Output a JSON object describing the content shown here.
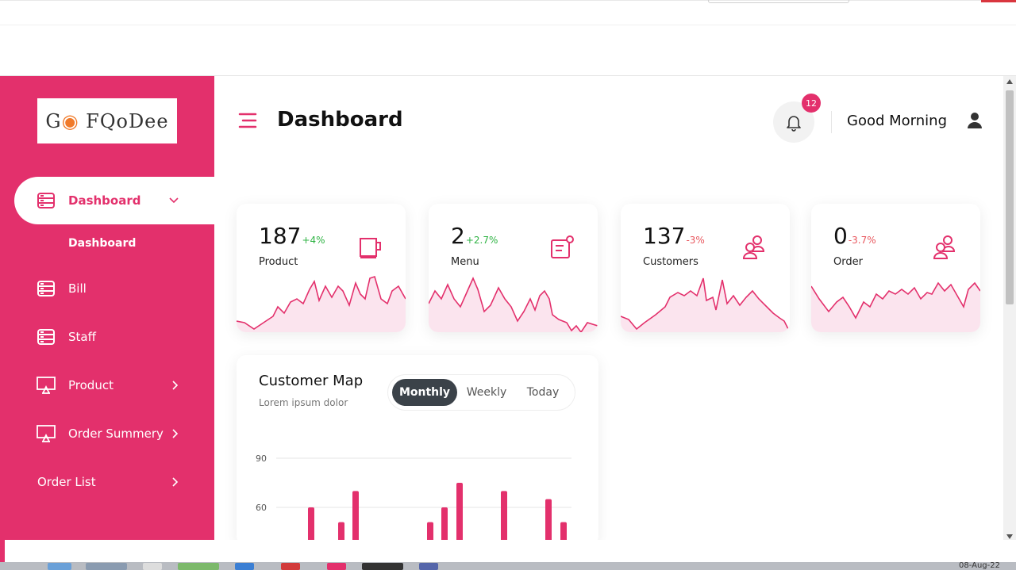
{
  "brand": {
    "logo_text": "GO FOoDee",
    "accent": "#e3306c",
    "dark": "#3b4249"
  },
  "sidebar": {
    "items": [
      {
        "label": "Dashboard",
        "icon": "list-icon",
        "active": true,
        "expanded": true
      },
      {
        "label": "Bill",
        "icon": "list-icon"
      },
      {
        "label": "Staff",
        "icon": "list-icon"
      },
      {
        "label": "Product",
        "icon": "monitor-icon"
      },
      {
        "label": "Order Summery",
        "icon": "monitor-icon"
      },
      {
        "label": "Order List"
      }
    ],
    "sub_items": [
      "Dashboard"
    ]
  },
  "header": {
    "title": "Dashboard",
    "notifications": "12",
    "greeting": "Good Morning"
  },
  "stats": [
    {
      "value": "187",
      "delta": "+4%",
      "label": "Product",
      "icon": "cup-icon",
      "trend": "up"
    },
    {
      "value": "2",
      "delta": "+2.7%",
      "label": "Menu",
      "icon": "menu-card-icon",
      "trend": "up"
    },
    {
      "value": "137",
      "delta": "-3%",
      "label": "Customers",
      "icon": "users-icon",
      "trend": "down"
    },
    {
      "value": "0",
      "delta": "-3.7%",
      "label": "Order",
      "icon": "users-icon",
      "trend": "down"
    }
  ],
  "customer_map": {
    "title": "Customer Map",
    "subtitle": "Lorem ipsum dolor",
    "tabs": [
      "Monthly",
      "Weekly",
      "Today"
    ],
    "active_tab": "Monthly"
  },
  "chart_data": {
    "type": "bar",
    "title": "Customer Map",
    "ytick_labels": [
      "90",
      "60"
    ],
    "ylim": [
      0,
      90
    ],
    "values": [
      60,
      51,
      70,
      51,
      60,
      75,
      70,
      65,
      51
    ],
    "color": "#e3306c",
    "note_visible_region": "chart is cut off below the 60 gridline"
  },
  "taskbar": {
    "date": "08-Aug-22"
  }
}
